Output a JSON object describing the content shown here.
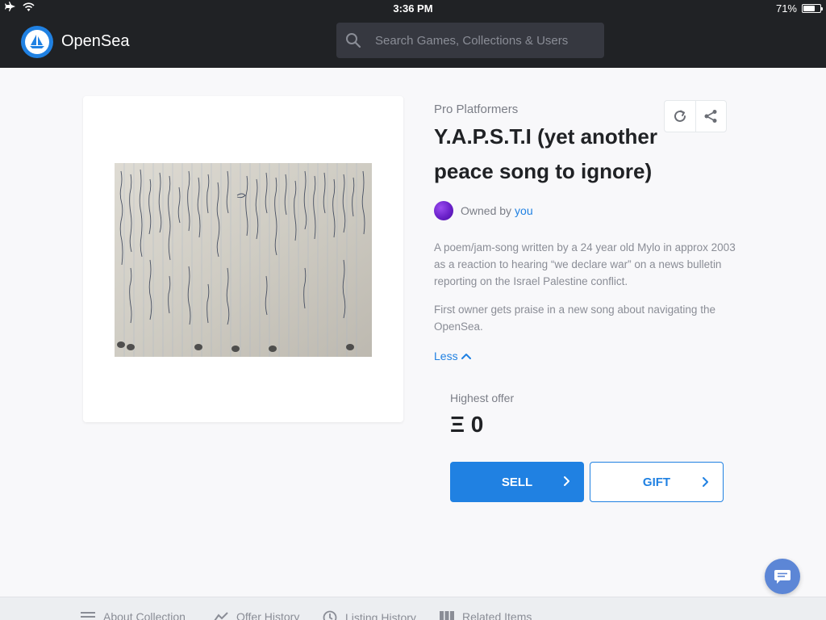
{
  "status_bar": {
    "time": "3:36 PM",
    "battery": "71%",
    "battery_level": 0.71
  },
  "header": {
    "brand": "OpenSea",
    "search_placeholder": "Search Games, Collections & Users"
  },
  "asset": {
    "collection": "Pro Platformers",
    "title": "Y.A.P.S.T.I (yet another peace song to ignore)",
    "owner_prefix": "Owned by",
    "owner": "you",
    "description_1": "A poem/jam-song written by a 24 year old Mylo in approx 2003 as a reaction to hearing “we declare war” on a news bulletin reporting on the Israel Palestine conflict.",
    "description_2": "First owner gets praise in a new song about navigating the OpenSea.",
    "less_label": "Less"
  },
  "offer": {
    "label": "Highest offer",
    "value": "Ξ 0"
  },
  "buttons": {
    "sell": "SELL",
    "gift": "GIFT"
  },
  "tabs": [
    {
      "label": "About Collection",
      "icon": "menu-icon"
    },
    {
      "label": "Offer History",
      "icon": "chart-icon"
    },
    {
      "label": "Listing History",
      "icon": "clock-icon"
    },
    {
      "label": "Related Items",
      "icon": "grid-icon"
    }
  ],
  "colors": {
    "header_bg": "#202225",
    "accent": "#2081e2",
    "chat_bubble": "#5c86d6"
  }
}
